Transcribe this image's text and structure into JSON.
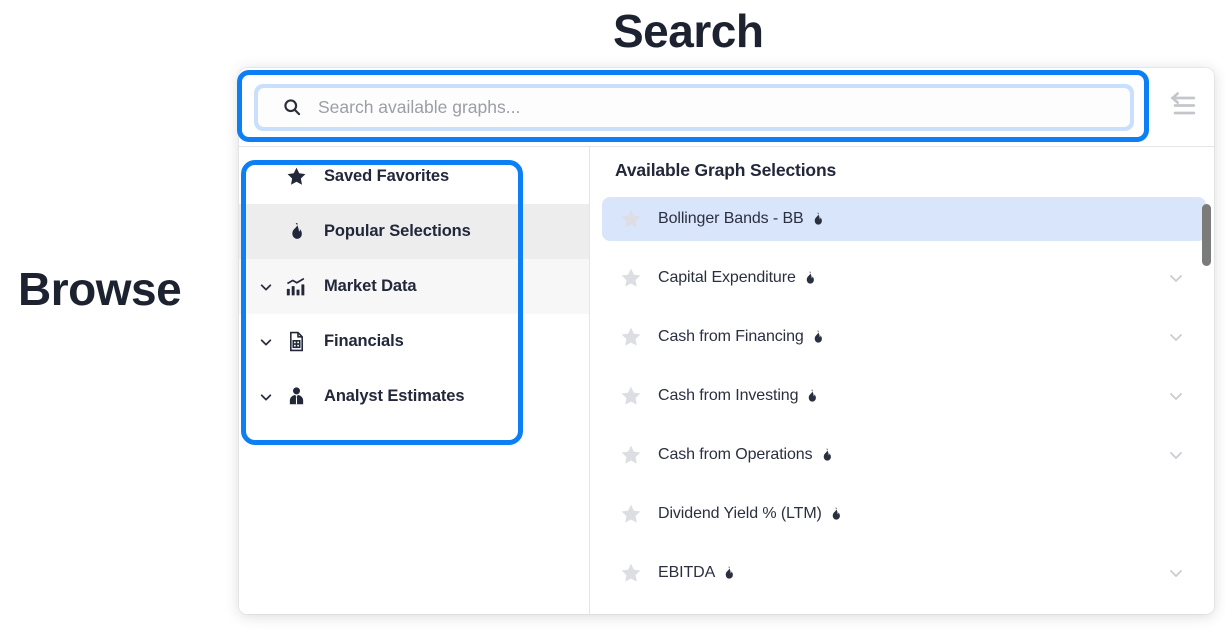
{
  "annotations": {
    "search_label": "Search",
    "browse_label": "Browse"
  },
  "search": {
    "placeholder": "Search available graphs...",
    "value": "",
    "icon": "search-icon"
  },
  "toolbar": {
    "collapse_icon": "collapse-panel-icon"
  },
  "sidebar": {
    "items": [
      {
        "label": "Saved Favorites",
        "icon": "star-icon",
        "expandable": false,
        "bg": "white"
      },
      {
        "label": "Popular Selections",
        "icon": "flame-icon",
        "expandable": false,
        "bg": "#ededee"
      },
      {
        "label": "Market Data",
        "icon": "bar-chart-icon",
        "expandable": true,
        "bg": "#f7f7f8"
      },
      {
        "label": "Financials",
        "icon": "document-icon",
        "expandable": true,
        "bg": "white"
      },
      {
        "label": "Analyst Estimates",
        "icon": "analyst-icon",
        "expandable": true,
        "bg": "white"
      }
    ]
  },
  "main": {
    "title": "Available Graph Selections",
    "graphs": [
      {
        "label": "Bollinger Bands - BB",
        "popular": true,
        "selected": true,
        "expandable": false
      },
      {
        "label": "Capital Expenditure",
        "popular": true,
        "selected": false,
        "expandable": true
      },
      {
        "label": "Cash from Financing",
        "popular": true,
        "selected": false,
        "expandable": true
      },
      {
        "label": "Cash from Investing",
        "popular": true,
        "selected": false,
        "expandable": true
      },
      {
        "label": "Cash from Operations",
        "popular": true,
        "selected": false,
        "expandable": true
      },
      {
        "label": "Dividend Yield % (LTM)",
        "popular": true,
        "selected": false,
        "expandable": false
      },
      {
        "label": "EBITDA",
        "popular": true,
        "selected": false,
        "expandable": true
      }
    ]
  },
  "colors": {
    "annotation_blue": "#0c7ff5",
    "selected_row": "#d9e5fb",
    "focus_ring": "#c9dffb",
    "text_dark": "#22283a",
    "star_gray": "#dcdee4"
  }
}
